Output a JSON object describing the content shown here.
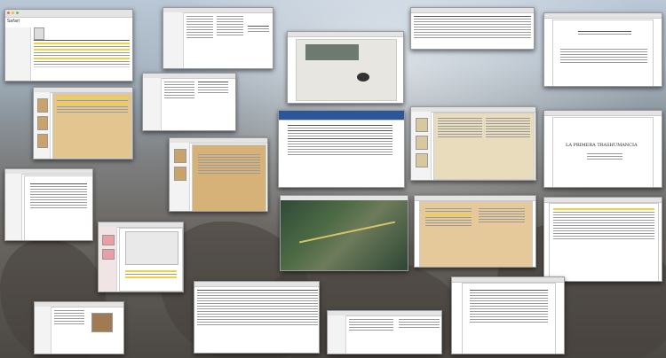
{
  "desktop": {
    "colors": {
      "sky": "#b9c7d6",
      "rock": "#6d6a66",
      "page": "#ffffff",
      "old_paper": "#e3c58f",
      "highlight": "#f1d23a"
    }
  },
  "windows": [
    {
      "id": "w1",
      "type": "browser",
      "label": "Safari"
    },
    {
      "id": "w2",
      "type": "finder"
    },
    {
      "id": "w3",
      "type": "photo"
    },
    {
      "id": "w4",
      "type": "table"
    },
    {
      "id": "w5",
      "type": "document"
    },
    {
      "id": "w6",
      "type": "scan"
    },
    {
      "id": "w7",
      "type": "finder"
    },
    {
      "id": "w8",
      "type": "word"
    },
    {
      "id": "w9",
      "type": "book"
    },
    {
      "id": "w10",
      "type": "document",
      "title": "LA PRIMERA TRASHUMANCIA"
    },
    {
      "id": "w11",
      "type": "scan"
    },
    {
      "id": "w12",
      "type": "document"
    },
    {
      "id": "w13",
      "type": "map"
    },
    {
      "id": "w14",
      "type": "pdf-map"
    },
    {
      "id": "w15",
      "type": "book"
    },
    {
      "id": "w16",
      "type": "document"
    },
    {
      "id": "w17",
      "type": "table"
    },
    {
      "id": "w18",
      "type": "finder"
    },
    {
      "id": "w19",
      "type": "document"
    },
    {
      "id": "w20",
      "type": "finder"
    }
  ]
}
